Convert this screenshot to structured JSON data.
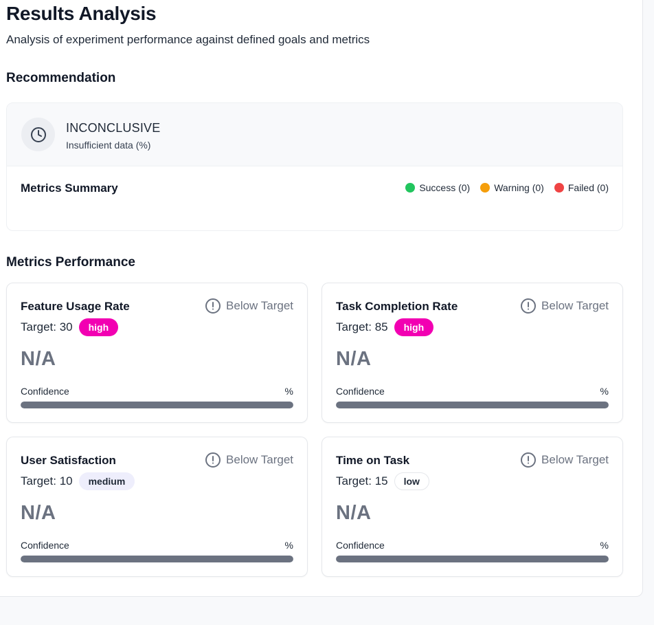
{
  "page": {
    "title": "Results Analysis",
    "subtitle": "Analysis of experiment performance against defined goals and metrics"
  },
  "recommendation": {
    "section_title": "Recommendation",
    "icon": "clock-icon",
    "status": "INCONCLUSIVE",
    "reason": "Insufficient data (%)",
    "summary_title": "Metrics Summary",
    "legend": [
      {
        "label": "Success (0)",
        "color": "#22c55e"
      },
      {
        "label": "Warning (0)",
        "color": "#f59e0b"
      },
      {
        "label": "Failed (0)",
        "color": "#ef4444"
      }
    ]
  },
  "metrics": {
    "section_title": "Metrics Performance",
    "status_icon": "alert-circle-icon",
    "items": [
      {
        "name": "Feature Usage Rate",
        "status": "Below Target",
        "target_prefix": "Target: 30",
        "priority": "high",
        "value": "N/A",
        "confidence_label": "Confidence",
        "confidence_unit": "%",
        "confidence_fill": 1.0
      },
      {
        "name": "Task Completion Rate",
        "status": "Below Target",
        "target_prefix": "Target: 85",
        "priority": "high",
        "value": "N/A",
        "confidence_label": "Confidence",
        "confidence_unit": "%",
        "confidence_fill": 1.0
      },
      {
        "name": "User Satisfaction",
        "status": "Below Target",
        "target_prefix": "Target: 10",
        "priority": "medium",
        "value": "N/A",
        "confidence_label": "Confidence",
        "confidence_unit": "%",
        "confidence_fill": 1.0
      },
      {
        "name": "Time on Task",
        "status": "Below Target",
        "target_prefix": "Target: 15",
        "priority": "low",
        "value": "N/A",
        "confidence_label": "Confidence",
        "confidence_unit": "%",
        "confidence_fill": 1.0
      }
    ]
  },
  "colors": {
    "accent_high": "#f200b2",
    "muted_text": "#6b7280",
    "bar_fill": "#6b7280"
  }
}
